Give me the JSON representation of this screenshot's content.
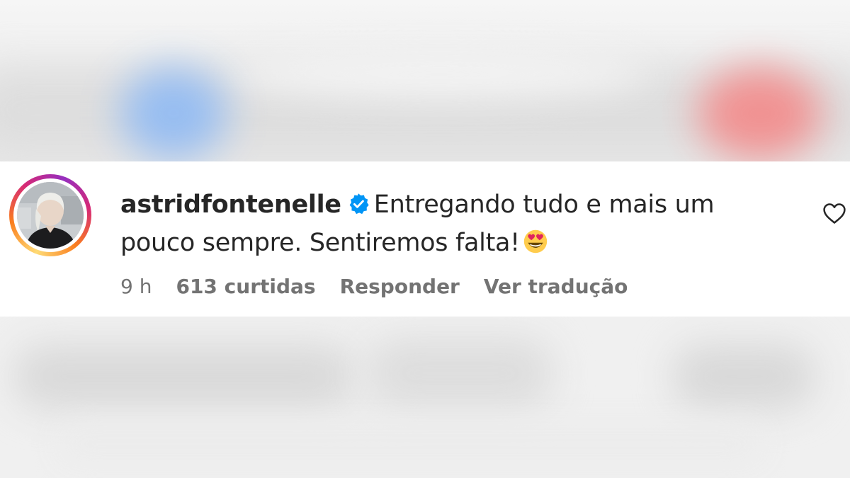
{
  "comment": {
    "username": "astridfontenelle",
    "verified": true,
    "text_line_1": "Entregando tudo e mais um",
    "text_line_2": "pouco sempre. Sentiremos falta!",
    "emoji": "smiling-face-with-heart-eyes",
    "time": "9 h",
    "likes": "613 curtidas",
    "reply_label": "Responder",
    "translate_label": "Ver tradução"
  },
  "colors": {
    "text": "#262626",
    "meta": "#737373",
    "verified": "#0095f6",
    "story_ring": [
      "#feda75",
      "#fa7e1e",
      "#d62976",
      "#962fbf"
    ]
  },
  "icons": {
    "like": "heart-outline-icon",
    "verified": "verified-badge-icon"
  }
}
